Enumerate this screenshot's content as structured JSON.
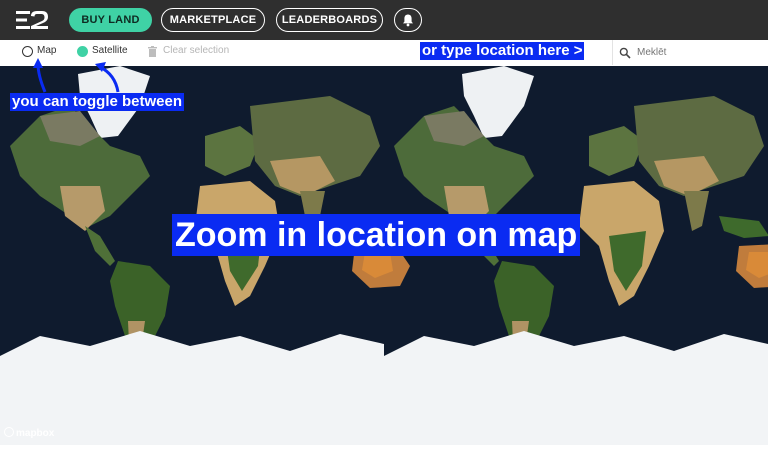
{
  "nav": {
    "logo_icon": "e2-logo-icon",
    "buy_land_label": "BUY LAND",
    "marketplace_label": "MARKETPLACE",
    "leaderboards_label": "LEADERBOARDS",
    "notifications_icon": "bell-icon",
    "accent_color": "#3fd2a5"
  },
  "toolbar": {
    "map_label": "Map",
    "satellite_label": "Satellite",
    "selected_view": "Satellite",
    "clear_selection_label": "Clear selection",
    "clear_icon": "trash-icon"
  },
  "search": {
    "icon": "search-icon",
    "value": "Meklēt"
  },
  "annotations": {
    "toggle_note": "you can toggle between",
    "search_note": "or type location here >",
    "zoom_note": "Zoom in location on map"
  },
  "map": {
    "attribution": "mapbox",
    "style": "satellite"
  }
}
